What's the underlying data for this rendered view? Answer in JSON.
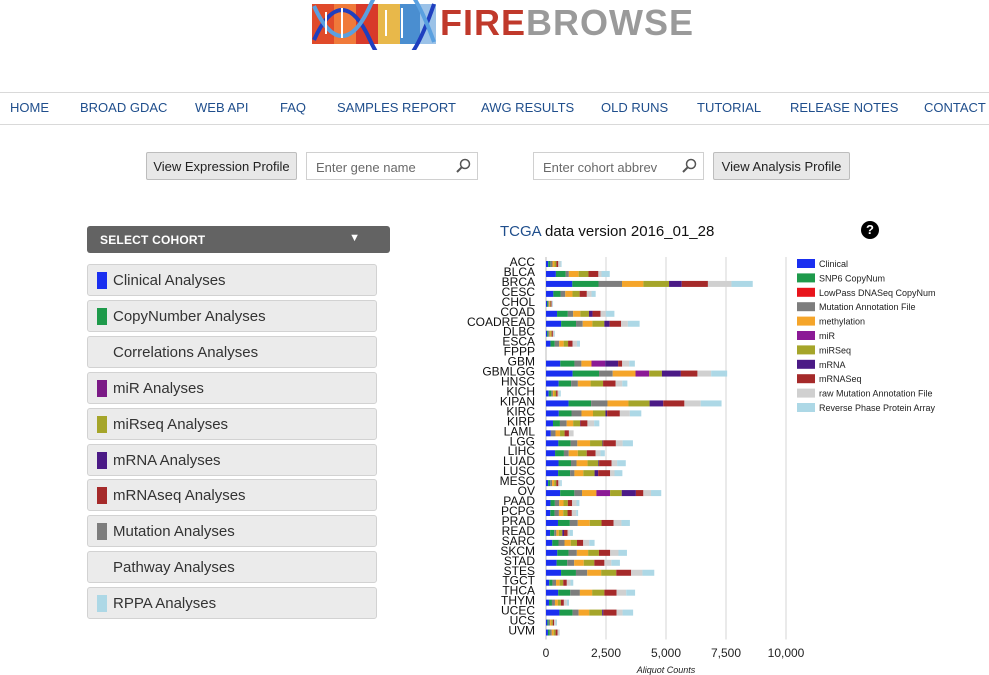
{
  "logo": {
    "name_fire": "FIRE",
    "name_browse": "BROWSE"
  },
  "nav": [
    {
      "label": "HOME"
    },
    {
      "label": "BROAD GDAC"
    },
    {
      "label": "WEB API"
    },
    {
      "label": "FAQ"
    },
    {
      "label": "SAMPLES REPORT"
    },
    {
      "label": "AWG RESULTS"
    },
    {
      "label": "OLD RUNS"
    },
    {
      "label": "TUTORIAL"
    },
    {
      "label": "RELEASE NOTES"
    },
    {
      "label": "CONTACT"
    }
  ],
  "search": {
    "expression_button": "View Expression Profile",
    "gene_placeholder": "Enter gene name",
    "cohort_placeholder": "Enter cohort abbrev",
    "analysis_button": "View Analysis Profile"
  },
  "sidebar": {
    "select_label": "SELECT COHORT",
    "items": [
      {
        "label": "Clinical Analyses",
        "color": "#1a2ff0"
      },
      {
        "label": "CopyNumber Analyses",
        "color": "#1e9a4b"
      },
      {
        "label": "Correlations Analyses",
        "color": ""
      },
      {
        "label": "miR Analyses",
        "color": "#7b1a86"
      },
      {
        "label": "miRseq Analyses",
        "color": "#a5a52a"
      },
      {
        "label": "mRNA Analyses",
        "color": "#4b1a86"
      },
      {
        "label": "mRNAseq Analyses",
        "color": "#a52a2a"
      },
      {
        "label": "Mutation Analyses",
        "color": "#7d7d7d"
      },
      {
        "label": "Pathway Analyses",
        "color": ""
      },
      {
        "label": "RPPA Analyses",
        "color": "#add8e6"
      }
    ]
  },
  "chart_header": {
    "prefix": "TCGA",
    "suffix": "data version 2016_01_28",
    "help": "?"
  },
  "chart_data": {
    "type": "bar",
    "stacked": true,
    "orientation": "horizontal",
    "xlabel": "Aliquot Counts",
    "xlim": [
      0,
      10000
    ],
    "xticks": [
      0,
      2500,
      5000,
      7500,
      10000
    ],
    "xtick_labels": [
      "0",
      "2,500",
      "5,000",
      "7,500",
      "10,000"
    ],
    "grid": true,
    "legend_position": "right",
    "categories": [
      "ACC",
      "BLCA",
      "BRCA",
      "CESC",
      "CHOL",
      "COAD",
      "COADREAD",
      "DLBC",
      "ESCA",
      "FPPP",
      "GBM",
      "GBMLGG",
      "HNSC",
      "KICH",
      "KIPAN",
      "KIRC",
      "KIRP",
      "LAML",
      "LGG",
      "LIHC",
      "LUAD",
      "LUSC",
      "MESO",
      "OV",
      "PAAD",
      "PCPG",
      "PRAD",
      "READ",
      "SARC",
      "SKCM",
      "STAD",
      "STES",
      "TGCT",
      "THCA",
      "THYM",
      "UCEC",
      "UCS",
      "UVM"
    ],
    "series": [
      {
        "name": "Clinical",
        "color": "#1a2ff0",
        "values": [
          92,
          412,
          1097,
          307,
          45,
          460,
          631,
          48,
          185,
          0,
          595,
          1110,
          528,
          113,
          941,
          533,
          291,
          200,
          515,
          377,
          522,
          504,
          87,
          591,
          185,
          179,
          499,
          171,
          261,
          470,
          443,
          628,
          134,
          507,
          124,
          560,
          57,
          80
        ]
      },
      {
        "name": "SNP6 CopyNum",
        "color": "#1e9a4b",
        "values": [
          90,
          410,
          1090,
          300,
          40,
          450,
          620,
          48,
          180,
          0,
          590,
          1100,
          520,
          110,
          940,
          530,
          290,
          0,
          510,
          370,
          520,
          500,
          87,
          590,
          185,
          179,
          495,
          170,
          260,
          470,
          440,
          620,
          134,
          505,
          124,
          550,
          56,
          80
        ]
      },
      {
        "name": "LowPass DNASeq CopyNum",
        "color": "#e8141b",
        "values": [
          0,
          0,
          0,
          0,
          0,
          0,
          0,
          0,
          0,
          0,
          0,
          0,
          0,
          0,
          0,
          0,
          0,
          0,
          0,
          0,
          0,
          0,
          0,
          0,
          0,
          0,
          0,
          0,
          0,
          0,
          0,
          0,
          0,
          0,
          0,
          0,
          0,
          0
        ]
      },
      {
        "name": "Mutation Annotation File",
        "color": "#7d7d7d",
        "values": [
          90,
          130,
          980,
          195,
          35,
          220,
          280,
          48,
          185,
          0,
          290,
          570,
          280,
          65,
          680,
          415,
          280,
          195,
          280,
          200,
          230,
          180,
          80,
          320,
          180,
          180,
          330,
          90,
          250,
          345,
          290,
          470,
          150,
          400,
          125,
          250,
          57,
          80
        ]
      },
      {
        "name": "methylation",
        "color": "#f5a52a",
        "values": [
          80,
          410,
          890,
          300,
          36,
          300,
          400,
          48,
          185,
          0,
          420,
          950,
          530,
          66,
          875,
          480,
          270,
          190,
          530,
          380,
          460,
          370,
          87,
          600,
          180,
          180,
          500,
          100,
          260,
          470,
          400,
          580,
          150,
          510,
          124,
          440,
          57,
          80
        ]
      },
      {
        "name": "miR",
        "color": "#8b1a96",
        "values": [
          0,
          0,
          0,
          0,
          0,
          0,
          0,
          0,
          0,
          0,
          570,
          570,
          0,
          0,
          0,
          0,
          0,
          0,
          0,
          0,
          0,
          0,
          0,
          570,
          0,
          0,
          0,
          0,
          0,
          0,
          0,
          0,
          0,
          0,
          0,
          0,
          0,
          0
        ]
      },
      {
        "name": "miRSeq",
        "color": "#a5a52a",
        "values": [
          80,
          410,
          1070,
          300,
          36,
          360,
          500,
          47,
          185,
          0,
          0,
          530,
          520,
          66,
          880,
          520,
          290,
          190,
          520,
          370,
          450,
          470,
          87,
          485,
          180,
          180,
          490,
          150,
          260,
          450,
          440,
          630,
          150,
          510,
          124,
          540,
          57,
          80
        ]
      },
      {
        "name": "mRNA",
        "color": "#4b1a86",
        "values": [
          0,
          0,
          530,
          0,
          0,
          150,
          220,
          0,
          0,
          0,
          540,
          790,
          0,
          0,
          570,
          70,
          15,
          0,
          27,
          0,
          30,
          150,
          0,
          590,
          0,
          0,
          0,
          70,
          0,
          0,
          0,
          0,
          0,
          0,
          0,
          50,
          0,
          0
        ]
      },
      {
        "name": "mRNASeq",
        "color": "#a52a2a",
        "values": [
          80,
          410,
          1090,
          300,
          36,
          330,
          480,
          48,
          185,
          0,
          170,
          690,
          520,
          66,
          880,
          530,
          290,
          180,
          530,
          370,
          520,
          500,
          87,
          310,
          180,
          180,
          500,
          150,
          260,
          470,
          420,
          620,
          150,
          510,
          124,
          550,
          57,
          80
        ]
      },
      {
        "name": "raw Mutation Annotation File",
        "color": "#d0d0d0",
        "values": [
          90,
          130,
          980,
          195,
          35,
          220,
          280,
          48,
          185,
          0,
          290,
          570,
          280,
          65,
          680,
          415,
          280,
          195,
          280,
          200,
          230,
          180,
          80,
          320,
          180,
          180,
          330,
          90,
          250,
          345,
          290,
          470,
          150,
          400,
          125,
          250,
          57,
          80
        ]
      },
      {
        "name": "Reverse Phase Protein Array",
        "color": "#add8e6",
        "values": [
          46,
          344,
          887,
          173,
          30,
          360,
          490,
          33,
          126,
          0,
          238,
          668,
          212,
          63,
          869,
          478,
          216,
          0,
          430,
          184,
          362,
          328,
          63,
          426,
          123,
          80,
          352,
          130,
          223,
          353,
          357,
          493,
          118,
          370,
          90,
          440,
          57,
          12
        ]
      }
    ]
  }
}
